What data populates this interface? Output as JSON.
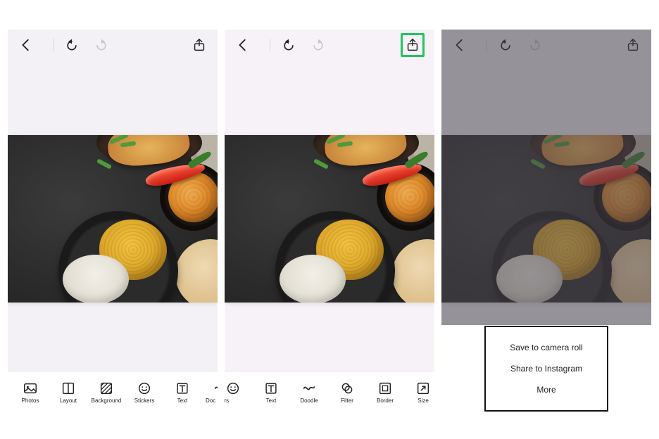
{
  "icons": {
    "back": "back-chevron-icon",
    "undo": "undo-icon",
    "redo": "redo-icon",
    "share": "share-icon"
  },
  "toolbar_panel1": {
    "photos": {
      "label": "Photos",
      "icon": "photos-icon"
    },
    "layout": {
      "label": "Layout",
      "icon": "layout-icon"
    },
    "background": {
      "label": "Background",
      "icon": "background-icon"
    },
    "stickers": {
      "label": "Stickers",
      "icon": "stickers-icon"
    },
    "text": {
      "label": "Text",
      "icon": "text-icon"
    },
    "doodle_cut": {
      "label": "Doc",
      "icon": "doodle-icon"
    }
  },
  "toolbar_panel2": {
    "stickers_cut": {
      "label": "kers",
      "icon": "stickers-icon"
    },
    "text": {
      "label": "Text",
      "icon": "text-icon"
    },
    "doodle": {
      "label": "Doodle",
      "icon": "doodle-icon"
    },
    "filter": {
      "label": "Filter",
      "icon": "filter-icon"
    },
    "border": {
      "label": "Border",
      "icon": "border-icon"
    },
    "size": {
      "label": "Size",
      "icon": "size-icon"
    }
  },
  "share_menu": {
    "save": "Save to camera roll",
    "share": "Share to Instagram",
    "more": "More"
  },
  "canvas": {
    "description": "food-photo-on-dark-surface"
  },
  "highlight": {
    "panel2_share": true
  }
}
